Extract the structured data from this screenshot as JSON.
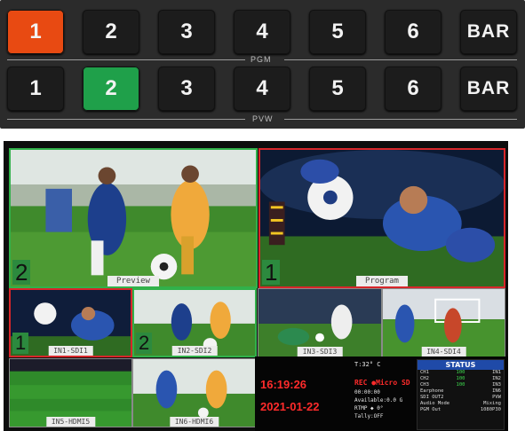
{
  "panel": {
    "pgm_keys": [
      "1",
      "2",
      "3",
      "4",
      "5",
      "6",
      "BAR"
    ],
    "pvw_keys": [
      "1",
      "2",
      "3",
      "4",
      "5",
      "6",
      "BAR"
    ],
    "pgm_label": "PGM",
    "pvw_label": "PVW",
    "pgm_active": "1",
    "pvw_active": "2",
    "colors": {
      "pgm": "#e84a12",
      "pvw": "#1fa04a"
    }
  },
  "multiview": {
    "preview": {
      "label": "Preview",
      "source_num": "2"
    },
    "program": {
      "label": "Program",
      "source_num": "1"
    },
    "inputs": [
      {
        "label": "IN1-SDI1",
        "tally": "1"
      },
      {
        "label": "IN2-SDI2",
        "tally": "2"
      },
      {
        "label": "IN3-SDI3",
        "tally": ""
      },
      {
        "label": "IN4-SDI4",
        "tally": ""
      },
      {
        "label": "IN5-HDMI5",
        "tally": ""
      },
      {
        "label": "IN6-HDMI6",
        "tally": ""
      }
    ],
    "info": {
      "time": "16:19:26",
      "date": "2021-01-22",
      "temp": "T:32° C",
      "rec": "REC ●Micro SD",
      "rec_time": "00:00:00",
      "available": "Available:0.0   G",
      "rtmp": "RTMP  ◆     0°",
      "tally": "Tally:OFF"
    },
    "status": {
      "title": "STATUS",
      "rows": [
        [
          "CH1",
          "100",
          "IN1"
        ],
        [
          "CH2",
          "100",
          "IN2"
        ],
        [
          "CH3",
          "100",
          "IN3"
        ],
        [
          "Earphone",
          "",
          "IN6"
        ],
        [
          "SDI OUT2",
          "",
          "PVW"
        ],
        [
          "Audio Mode",
          "",
          "Mixing"
        ],
        [
          "PGM Out",
          "",
          "1080P30"
        ]
      ]
    }
  }
}
